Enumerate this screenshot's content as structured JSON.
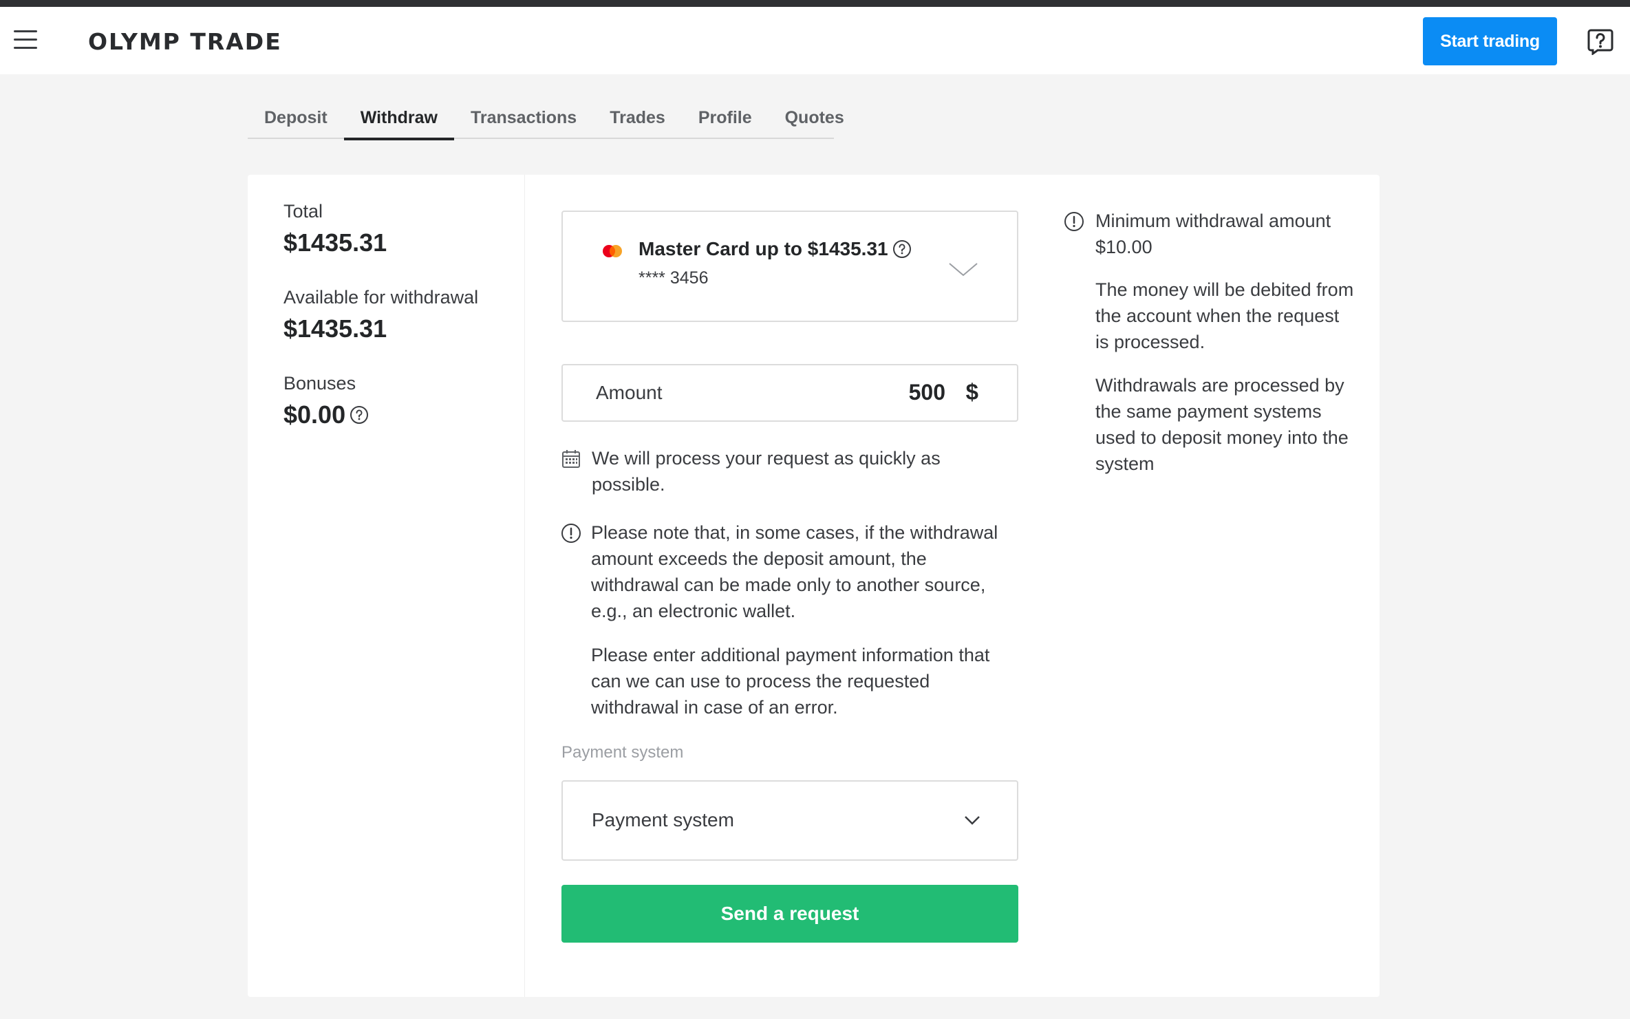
{
  "header": {
    "logo_text": "OLYMP TRADE",
    "start_trading_label": "Start trading"
  },
  "tabs": [
    {
      "label": "Deposit",
      "active": false
    },
    {
      "label": "Withdraw",
      "active": true
    },
    {
      "label": "Transactions",
      "active": false
    },
    {
      "label": "Trades",
      "active": false
    },
    {
      "label": "Profile",
      "active": false
    },
    {
      "label": "Quotes",
      "active": false
    }
  ],
  "balances": {
    "total_label": "Total",
    "total_value": "$1435.31",
    "available_label": "Available for withdrawal",
    "available_value": "$1435.31",
    "bonuses_label": "Bonuses",
    "bonuses_value": "$0.00"
  },
  "withdraw_form": {
    "card_title": "Master Card up to $1435.31",
    "card_number": "**** 3456",
    "amount_label": "Amount",
    "amount_value": "500",
    "amount_currency": "$",
    "process_note": "We will process your request as quickly as possible.",
    "warning_note": "Please note that, in some cases, if the withdrawal amount exceeds the deposit amount, the withdrawal can be made only to another source, e.g., an electronic wallet.",
    "additional_info_note": "Please enter additional payment information that can we can use to process the requested withdrawal in case of an error.",
    "payment_system_label": "Payment system",
    "payment_system_value": "Payment system",
    "send_button_label": "Send a request"
  },
  "info": {
    "minimum": "Minimum withdrawal amount $10.00",
    "debit_note": "The money will be debited from the account when the request is processed.",
    "processing_note": "Withdrawals are processed by the same payment systems used to deposit money into the system"
  },
  "colors": {
    "primary_blue": "#0b8cf4",
    "send_green": "#22bc74",
    "mastercard_red": "#eb001b",
    "mastercard_orange": "#f79e1b"
  },
  "icons": [
    "menu-icon",
    "help-icon",
    "mastercard-icon",
    "question-icon",
    "chevron-down-icon",
    "calendar-icon",
    "info-icon"
  ]
}
